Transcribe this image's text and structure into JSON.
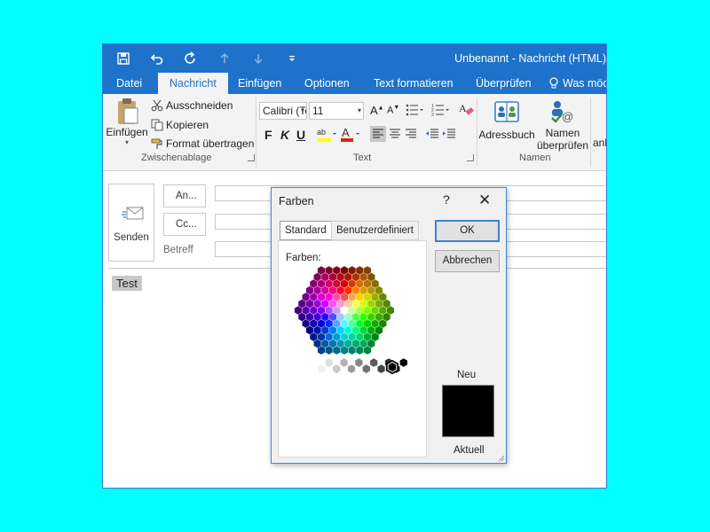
{
  "window": {
    "title": "Unbenannt - Nachricht (HTML)",
    "quick_access": [
      "save-icon",
      "undo-icon",
      "redo-icon",
      "up-arrow-icon",
      "down-arrow-icon",
      "customize-icon"
    ]
  },
  "tabs": [
    {
      "label": "Datei"
    },
    {
      "label": "Nachricht",
      "active": true
    },
    {
      "label": "Einfügen"
    },
    {
      "label": "Optionen"
    },
    {
      "label": "Text formatieren"
    },
    {
      "label": "Überprüfen"
    },
    {
      "label": "Was möchten Sie tun?"
    }
  ],
  "ribbon": {
    "clipboard": {
      "paste": "Einfügen",
      "cut": "Ausschneiden",
      "copy": "Kopieren",
      "format_painter": "Format übertragen",
      "group_label": "Zwischenablage"
    },
    "text": {
      "font": "Calibri (Textkörper)",
      "size": "11",
      "bold": "F",
      "italic": "K",
      "underline": "U",
      "group_label": "Text"
    },
    "names": {
      "address_book": "Adressbuch",
      "check_names_line1": "Namen",
      "check_names_line2": "überprüfen",
      "group_label": "Namen",
      "next_group": "anhängen"
    }
  },
  "compose": {
    "send": "Senden",
    "to": "An...",
    "cc": "Cc...",
    "subject": "Betreff",
    "body": "Test"
  },
  "dialog": {
    "title": "Farben",
    "help": "?",
    "close": "✕",
    "tabs": [
      "Standard",
      "Benutzerdefiniert"
    ],
    "colors_label": "Farben:",
    "ok": "OK",
    "cancel": "Abbrechen",
    "new_label": "Neu",
    "current_label": "Aktuell",
    "selected_color": "#000000"
  },
  "colors": {
    "accent": "#1e72c9",
    "background": "#00ffff"
  }
}
